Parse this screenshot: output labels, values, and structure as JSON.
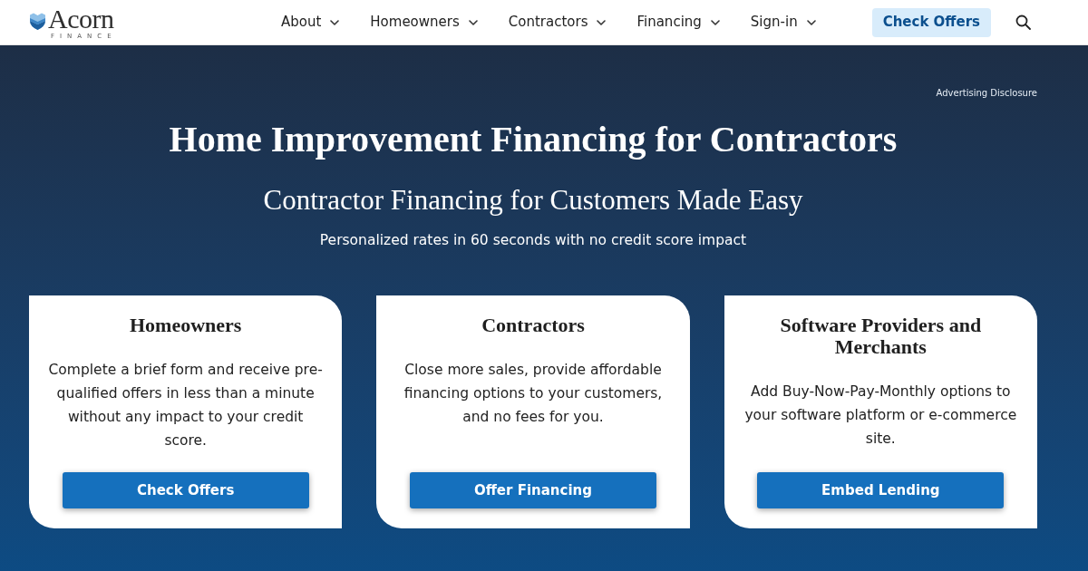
{
  "header": {
    "logo": {
      "name": "Acorn",
      "tagline": "FINANCE"
    },
    "nav": [
      {
        "label": "About"
      },
      {
        "label": "Homeowners"
      },
      {
        "label": "Contractors"
      },
      {
        "label": "Financing"
      },
      {
        "label": "Sign-in"
      }
    ],
    "cta": "Check Offers"
  },
  "hero": {
    "disclosure": "Advertising Disclosure",
    "title": "Home Improvement Financing for Contractors",
    "subtitle": "Contractor Financing for Customers Made Easy",
    "tagline": "Personalized rates in 60 seconds with no credit score impact"
  },
  "cards": [
    {
      "title": "Homeowners",
      "text": "Complete a brief form and receive pre-qualified offers in less than a minute without any impact to your credit score.",
      "button": "Check Offers"
    },
    {
      "title": "Contractors",
      "text": "Close more sales, provide affordable financing options to your customers, and no fees for you.",
      "button": "Offer Financing"
    },
    {
      "title": "Software Providers and Merchants",
      "text": "Add Buy-Now-Pay-Monthly options to your software platform or e-commerce site.",
      "button": "Embed Lending"
    }
  ]
}
